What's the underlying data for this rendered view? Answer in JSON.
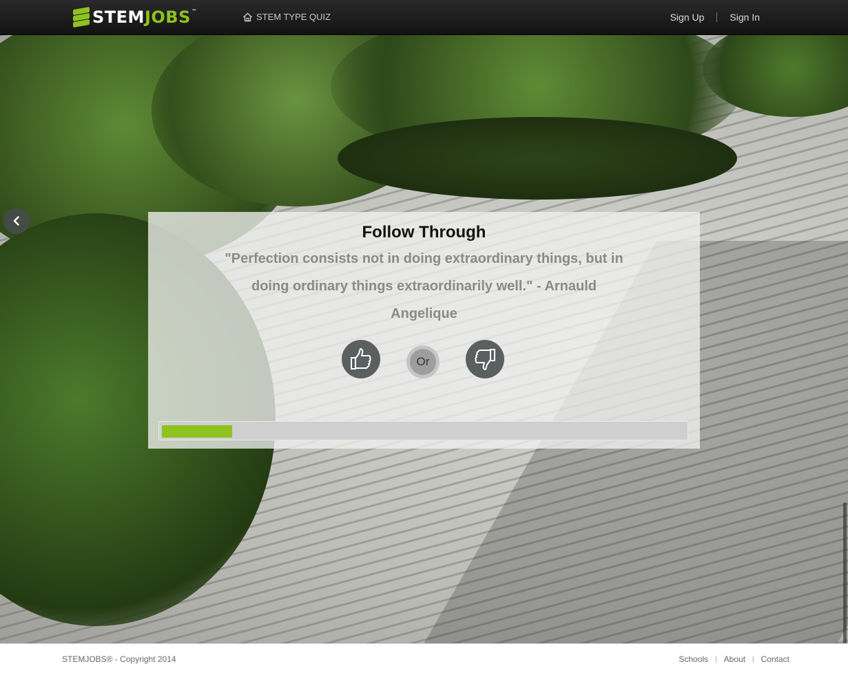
{
  "header": {
    "logo_stem": "STEM",
    "logo_jobs": "JOBS",
    "logo_tm": "™",
    "quiz_link": "STEM TYPE QUIZ",
    "sign_up": "Sign Up",
    "sign_in": "Sign In"
  },
  "card": {
    "title": "Follow Through",
    "quote": "\"Perfection consists not in doing extraordinary things, but in doing ordinary things extraordinarily well.\" - Arnauld Angelique",
    "or_label": "Or",
    "progress_fraction": 0.135
  },
  "icons": {
    "back": "chevron-left-icon",
    "home": "home-icon",
    "like": "thumbs-up-icon",
    "dislike": "thumbs-down-icon"
  },
  "colors": {
    "accent": "#8dc21f",
    "button": "#5a6060"
  },
  "footer": {
    "copyright": "STEMJOBS® - Copyright 2014",
    "links": [
      "Schools",
      "About",
      "Contact"
    ]
  }
}
